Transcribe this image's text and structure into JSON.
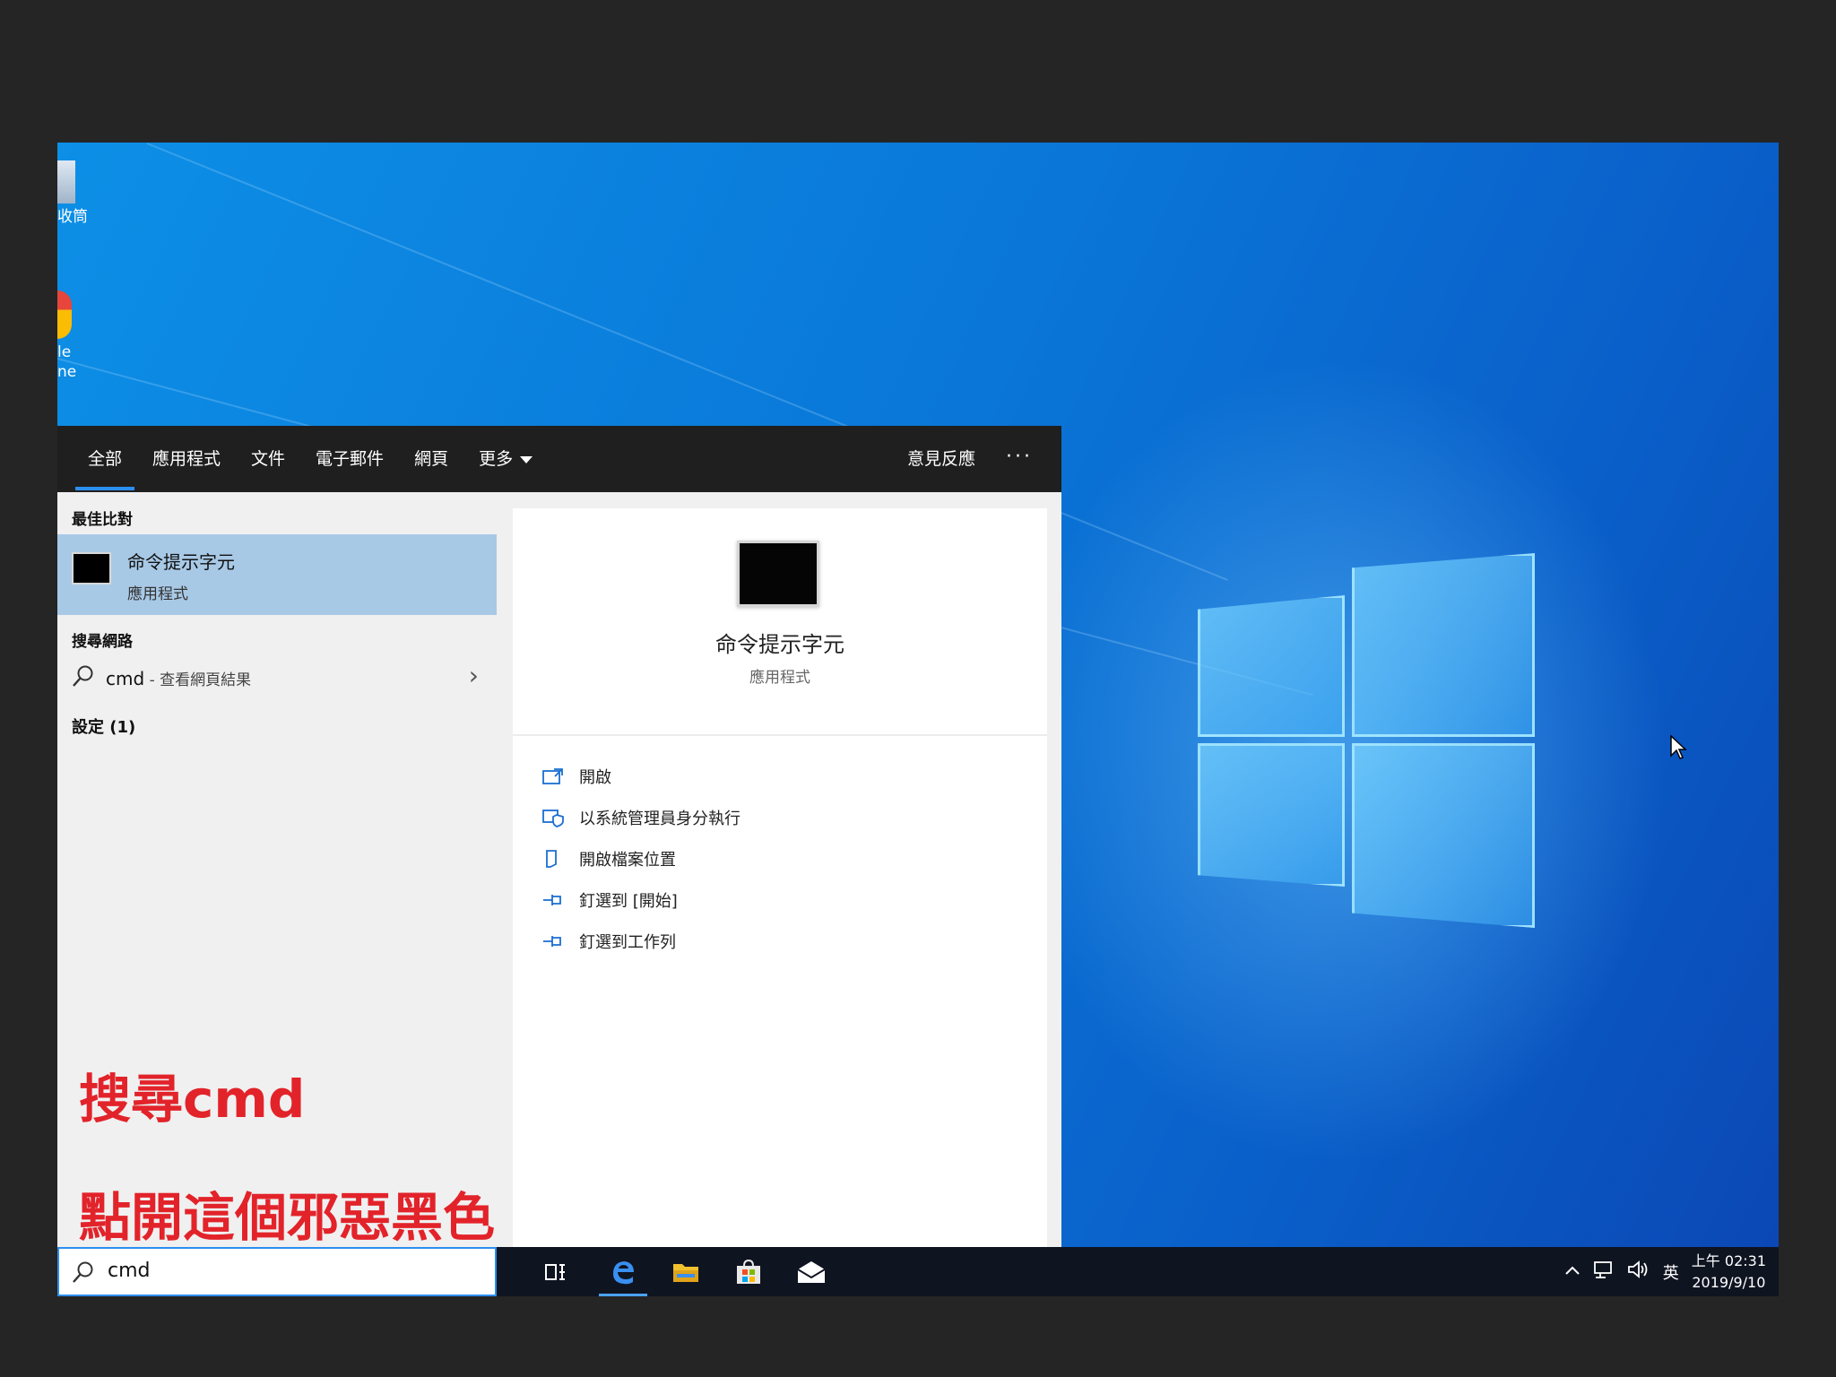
{
  "desktop": {
    "icons": [
      {
        "label": "收筒"
      },
      {
        "label": "le\nne"
      }
    ]
  },
  "search_panel": {
    "tabs": [
      {
        "label": "全部",
        "active": true
      },
      {
        "label": "應用程式"
      },
      {
        "label": "文件"
      },
      {
        "label": "電子郵件"
      },
      {
        "label": "網頁"
      },
      {
        "label": "更多"
      }
    ],
    "feedback_label": "意見反應",
    "more_dots": "···",
    "best_match": {
      "section": "最佳比對",
      "name": "命令提示字元",
      "type": "應用程式"
    },
    "web": {
      "section": "搜尋網路",
      "query": "cmd",
      "hint": " - 查看網頁結果"
    },
    "settings_section": "設定 (1)",
    "preview": {
      "name": "命令提示字元",
      "type": "應用程式"
    },
    "actions": [
      {
        "label": "開啟",
        "icon": "open-icon"
      },
      {
        "label": "以系統管理員身分執行",
        "icon": "admin-shield-icon"
      },
      {
        "label": "開啟檔案位置",
        "icon": "file-location-icon"
      },
      {
        "label": "釘選到 [開始]",
        "icon": "pin-icon"
      },
      {
        "label": "釘選到工作列",
        "icon": "pin-icon"
      }
    ]
  },
  "annotations": {
    "line1": "搜尋cmd",
    "line2": "點開這個邪惡黑色小方塊=="
  },
  "taskbar": {
    "search_value": "cmd",
    "ime": "英",
    "time": "上午 02:31",
    "date": "2019/9/10"
  },
  "colors": {
    "accent": "#2b8ef0",
    "selected_bg": "#a8c9e6",
    "annotation": "#e2232a",
    "taskbar": "#0f1421"
  }
}
